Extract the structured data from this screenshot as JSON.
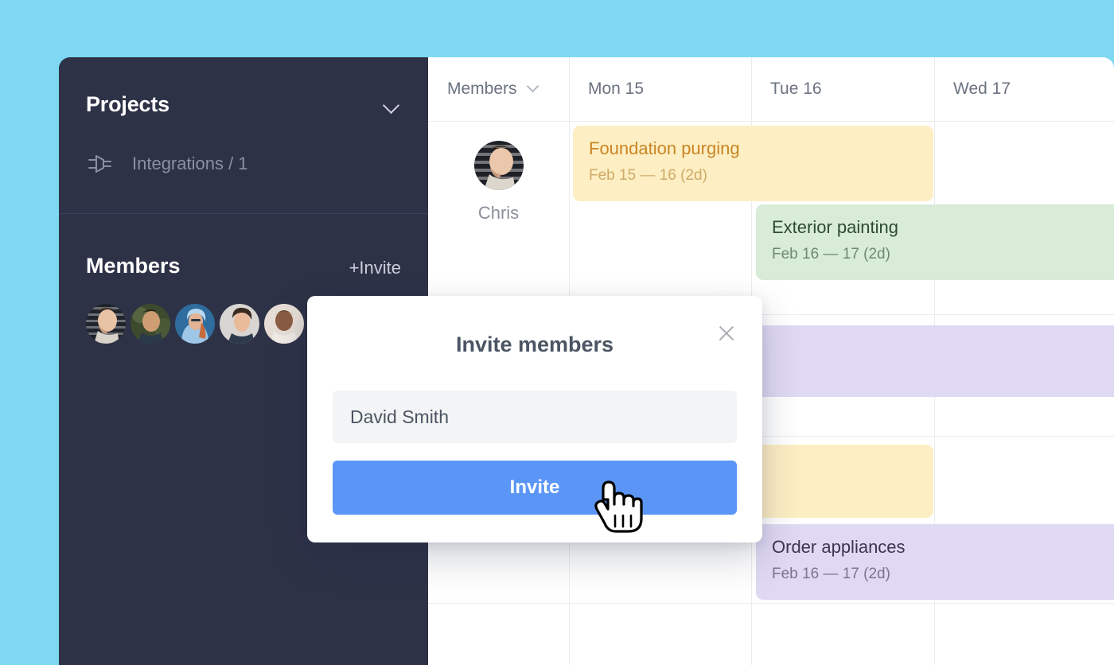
{
  "theme": {
    "page_bg": "#7ed8f2",
    "sidebar_bg": "#2e3247",
    "panel_bg": "#ffffff",
    "accent_blue": "#5b96f7",
    "bar_yellow": "#fdeec3",
    "bar_green": "#d8ecd8",
    "bar_purple": "#e0d9f3"
  },
  "sidebar": {
    "projects": {
      "title": "Projects",
      "collapse_icon": "chevron-down-icon",
      "items": [
        {
          "icon": "plug-icon",
          "label": "Integrations / 1"
        }
      ]
    },
    "members": {
      "title": "Members",
      "invite_label": "+Invite",
      "avatars": [
        {
          "name": "avatar-1"
        },
        {
          "name": "avatar-2"
        },
        {
          "name": "avatar-3"
        },
        {
          "name": "avatar-4"
        },
        {
          "name": "avatar-5"
        }
      ]
    }
  },
  "calendar": {
    "columns": [
      {
        "key": "members",
        "label": "Members",
        "has_dropdown": true
      },
      {
        "key": "mon15",
        "label": "Mon 15",
        "has_dropdown": false
      },
      {
        "key": "tue16",
        "label": "Tue 16",
        "has_dropdown": false
      },
      {
        "key": "wed17",
        "label": "Wed 17",
        "has_dropdown": false
      }
    ],
    "rows": [
      {
        "member": "Chris"
      }
    ],
    "tasks": [
      {
        "title": "Foundation purging",
        "dates": "Feb 15  — 16 (2d)",
        "color": "yellow"
      },
      {
        "title": "Exterior painting",
        "dates": "Feb 16  — 17 (2d)",
        "color": "green"
      },
      {
        "title": "",
        "dates": "",
        "color": "purple"
      },
      {
        "title": "",
        "dates": "",
        "color": "yellow"
      },
      {
        "title": "Order appliances",
        "dates": "Feb 16  — 17 (2d)",
        "color": "purple"
      }
    ]
  },
  "modal": {
    "title": "Invite members",
    "close_icon": "close-icon",
    "input_value": "David Smith",
    "input_placeholder": "David Smith",
    "submit_label": "Invite"
  },
  "cursor": {
    "icon": "pointing-hand-cursor"
  }
}
